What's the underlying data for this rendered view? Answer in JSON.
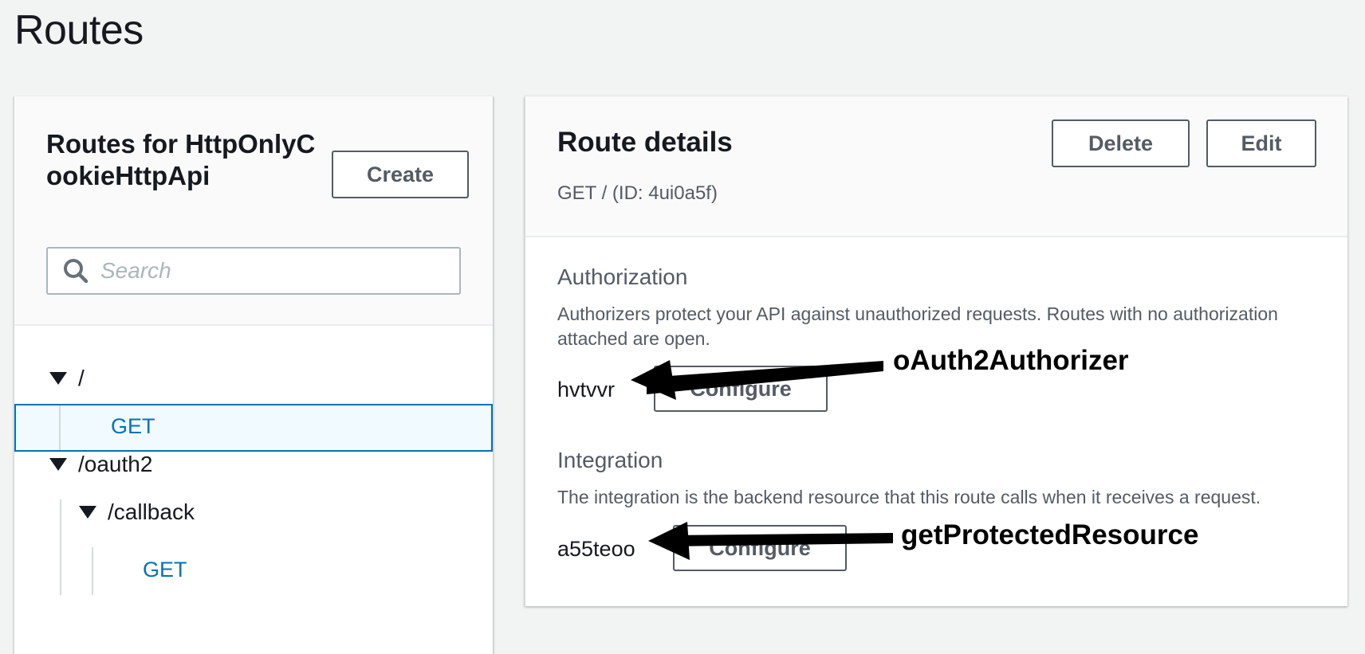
{
  "page": {
    "title": "Routes"
  },
  "left_panel": {
    "title": "Routes for HttpOnlyCookieHttpApi",
    "create_label": "Create",
    "search": {
      "placeholder": "Search",
      "value": ""
    },
    "tree": [
      {
        "path": "/",
        "expanded": true,
        "methods": [
          {
            "label": "GET",
            "selected": true
          }
        ]
      },
      {
        "path": "/oauth2",
        "expanded": true,
        "children": [
          {
            "path": "/callback",
            "expanded": true,
            "methods": [
              {
                "label": "GET",
                "selected": false
              }
            ]
          }
        ]
      }
    ]
  },
  "right_panel": {
    "title": "Route details",
    "subtitle": "GET / (ID: 4ui0a5f)",
    "delete_label": "Delete",
    "edit_label": "Edit",
    "authorization": {
      "title": "Authorization",
      "description": "Authorizers protect your API against unauthorized requests. Routes with no authorization attached are open.",
      "value": "hvtvvr",
      "configure_label": "Configure",
      "annotation": "oAuth2Authorizer"
    },
    "integration": {
      "title": "Integration",
      "description": "The integration is the backend resource that this route calls when it receives a request.",
      "value": "a55teoo",
      "configure_label": "Configure",
      "annotation": "getProtectedResource"
    }
  },
  "colors": {
    "accent": "#0073bb",
    "selected_bg": "#f1faff",
    "page_bg": "#f2f3f3",
    "text_secondary": "#545b64"
  }
}
